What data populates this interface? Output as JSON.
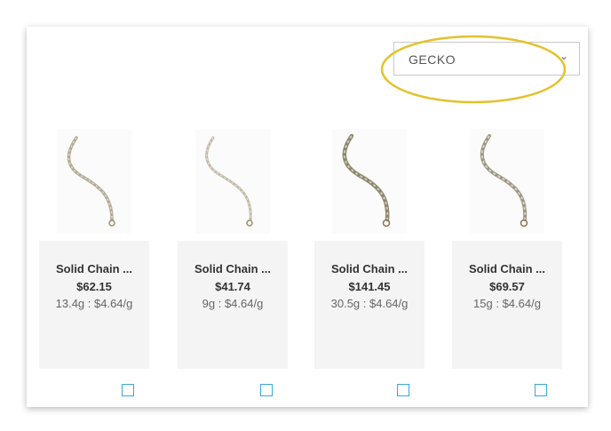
{
  "filter": {
    "selected": "GECKO",
    "chevron_icon": "chevron-down-icon"
  },
  "products": [
    {
      "name": "Solid Chain ...",
      "price": "$62.15",
      "weight_rate": "13.4g : $4.64/g",
      "checked": false
    },
    {
      "name": "Solid Chain ...",
      "price": "$41.74",
      "weight_rate": "9g : $4.64/g",
      "checked": false
    },
    {
      "name": "Solid Chain ...",
      "price": "$141.45",
      "weight_rate": "30.5g : $4.64/g",
      "checked": false
    },
    {
      "name": "Solid Chain ...",
      "price": "$69.57",
      "weight_rate": "15g : $4.64/g",
      "checked": false
    }
  ],
  "colors": {
    "highlight": "#e3c22d",
    "checkbox": "#3aa7d8",
    "card_bg": "#f4f4f4"
  }
}
